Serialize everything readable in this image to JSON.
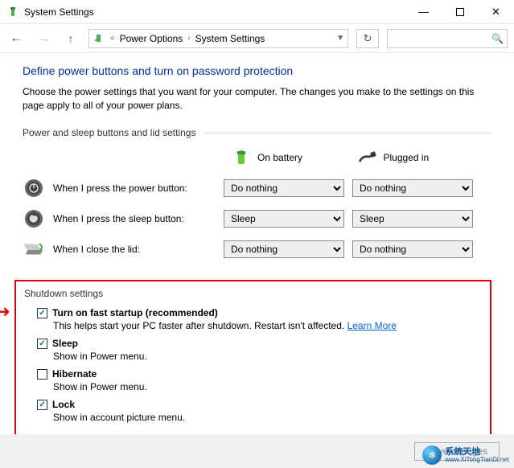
{
  "window": {
    "title": "System Settings"
  },
  "breadcrumb": {
    "item1": "Power Options",
    "item2": "System Settings"
  },
  "page": {
    "title": "Define power buttons and turn on password protection",
    "note": "Choose the power settings that you want for your computer. The changes you make to the settings on this page apply to all of your power plans."
  },
  "section1": {
    "label": "Power and sleep buttons and lid settings",
    "col_battery": "On battery",
    "col_plugged": "Plugged in",
    "rows": {
      "power": {
        "label": "When I press the power button:",
        "battery": "Do nothing",
        "plugged": "Do nothing"
      },
      "sleep": {
        "label": "When I press the sleep button:",
        "battery": "Sleep",
        "plugged": "Sleep"
      },
      "lid": {
        "label": "When I close the lid:",
        "battery": "Do nothing",
        "plugged": "Do nothing"
      }
    }
  },
  "shutdown": {
    "label": "Shutdown settings",
    "fast": {
      "title": "Turn on fast startup (recommended)",
      "desc": "This helps start your PC faster after shutdown. Restart isn't affected.",
      "link": "Learn More"
    },
    "sleep": {
      "title": "Sleep",
      "desc": "Show in Power menu."
    },
    "hibernate": {
      "title": "Hibernate",
      "desc": "Show in Power menu."
    },
    "lock": {
      "title": "Lock",
      "desc": "Show in account picture menu."
    }
  },
  "footer": {
    "save": "Save changes"
  },
  "watermark": {
    "name": "系统天地",
    "url": "www.XiTongTianDi.net"
  }
}
